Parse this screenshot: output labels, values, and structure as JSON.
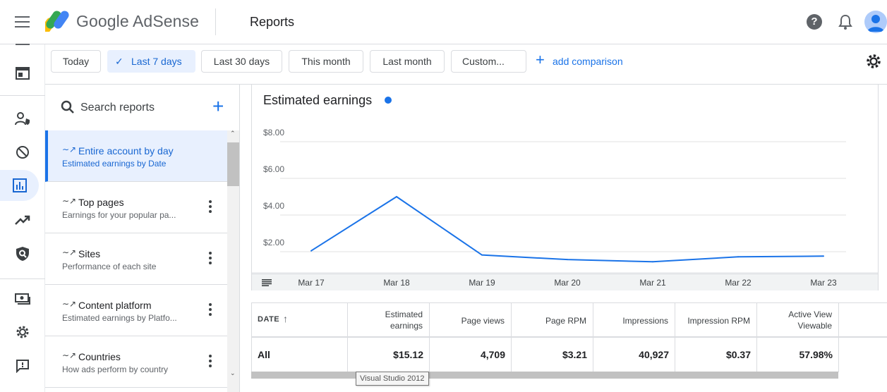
{
  "app": {
    "brand": "Google AdSense",
    "page_title": "Reports"
  },
  "colors": {
    "accent": "#1a73e8",
    "selected_bg": "#e8f0fe",
    "line": "#1a73e8"
  },
  "filters": {
    "today": "Today",
    "last7": "Last 7 days",
    "last30": "Last 30 days",
    "this_month": "This month",
    "last_month": "Last month",
    "custom": "Custom...",
    "add_comparison": "add comparison",
    "selected": "Last 7 days"
  },
  "side": {
    "search_placeholder": "Search reports",
    "reports": [
      {
        "title": "Entire account by day",
        "subtitle": "Estimated earnings by Date"
      },
      {
        "title": "Top pages",
        "subtitle": "Earnings for your popular pa..."
      },
      {
        "title": "Sites",
        "subtitle": "Performance of each site"
      },
      {
        "title": "Content platform",
        "subtitle": "Estimated earnings by Platfo..."
      },
      {
        "title": "Countries",
        "subtitle": "How ads perform by country"
      }
    ]
  },
  "chart_data": {
    "type": "line",
    "title": "Estimated earnings",
    "categories": [
      "Mar 17",
      "Mar 18",
      "Mar 19",
      "Mar 20",
      "Mar 21",
      "Mar 22",
      "Mar 23"
    ],
    "series": [
      {
        "values": [
          2.05,
          5.0,
          1.82,
          1.57,
          1.45,
          1.72,
          1.76
        ]
      }
    ],
    "y_ticks": [
      "$2.00",
      "$4.00",
      "$6.00",
      "$8.00"
    ],
    "ylim": [
      0,
      8
    ],
    "grid": true,
    "legend": "none"
  },
  "table": {
    "headers": [
      "DATE",
      "Estimated earnings",
      "Page views",
      "Page RPM",
      "Impressions",
      "Impression RPM",
      "Active View Viewable"
    ],
    "header_lines": [
      [
        "DATE"
      ],
      [
        "Estimated",
        "earnings"
      ],
      [
        "Page views"
      ],
      [
        "Page RPM"
      ],
      [
        "Impressions"
      ],
      [
        "Impression RPM"
      ],
      [
        "Active View",
        "Viewable"
      ]
    ],
    "row": [
      "All",
      "$15.12",
      "4,709",
      "$3.21",
      "40,927",
      "$0.37",
      "57.98%"
    ]
  },
  "tooltip": "Visual Studio 2012",
  "icons": [
    "menu-icon",
    "adsense-logo",
    "help-icon",
    "notifications-icon",
    "account-avatar",
    "settings-icon",
    "search-icon",
    "add-icon",
    "more-vert-icon",
    "table-view-icon"
  ]
}
